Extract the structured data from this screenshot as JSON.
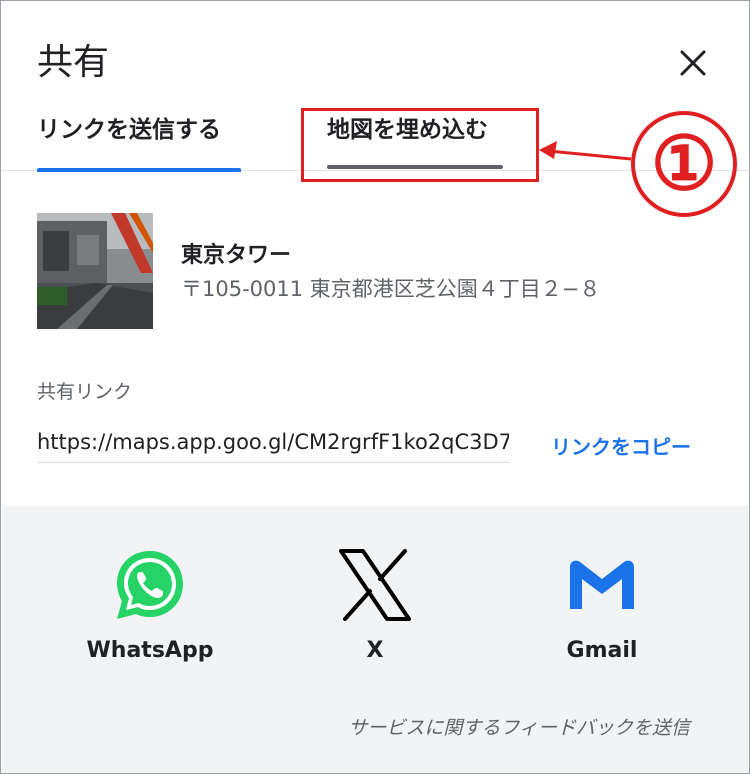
{
  "dialog": {
    "title": "共有"
  },
  "tabs": [
    {
      "label": "リンクを送信する",
      "active": true
    },
    {
      "label": "地図を埋め込む",
      "active": false
    }
  ],
  "annotation": {
    "marker": "①",
    "color": "#e02020"
  },
  "place": {
    "name": "東京タワー",
    "address": "〒105-0011 東京都港区芝公園４丁目２−８"
  },
  "share": {
    "label": "共有リンク",
    "url": "https://maps.app.goo.gl/CM2rgrfF1ko2qC3D7",
    "copy_label": "リンクをコピー"
  },
  "apps": [
    {
      "name": "WhatsApp",
      "icon": "whatsapp-icon",
      "color": "#25d366"
    },
    {
      "name": "X",
      "icon": "x-logo-icon",
      "color": "#000000"
    },
    {
      "name": "Gmail",
      "icon": "gmail-icon",
      "color": "#1a73e8"
    }
  ],
  "feedback": {
    "label": "サービスに関するフィードバックを送信"
  },
  "colors": {
    "accent": "#1a73e8",
    "bottom_bg": "#f1f3f4"
  }
}
